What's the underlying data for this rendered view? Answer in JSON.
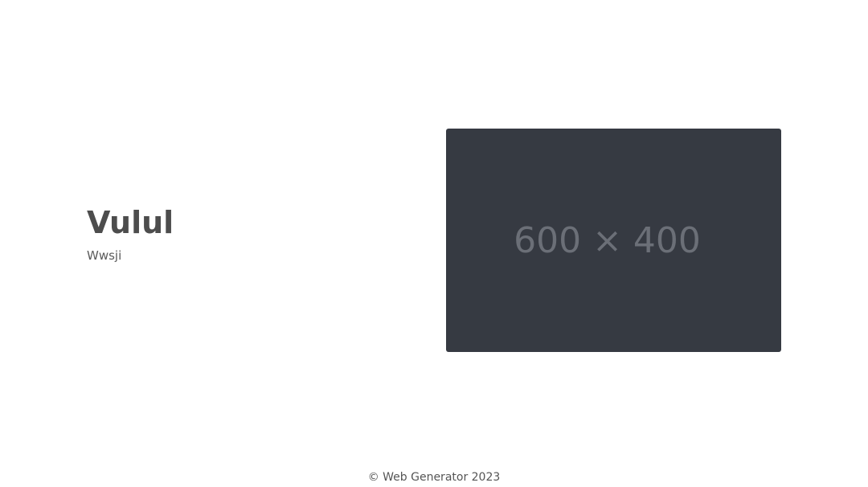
{
  "hero": {
    "title": "Vulul",
    "subtitle": "Wwsji"
  },
  "image": {
    "placeholder_text": "600 × 400"
  },
  "footer": {
    "text": "© Web Generator 2023"
  },
  "colors": {
    "image_bg": "#363a42",
    "image_text": "#6b6f77",
    "title_text": "#4d4d4d"
  }
}
